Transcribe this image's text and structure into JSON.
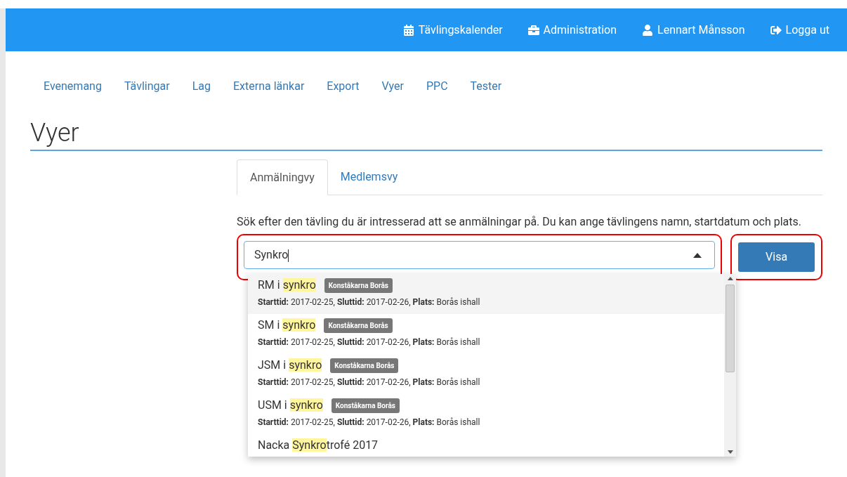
{
  "topbar": {
    "items": [
      {
        "kind": "calendar",
        "label": "Tävlingskalender"
      },
      {
        "kind": "briefcase",
        "label": "Administration"
      },
      {
        "kind": "user",
        "label": "Lennart Månsson"
      },
      {
        "kind": "logout",
        "label": "Logga ut"
      }
    ]
  },
  "nav": [
    "Evenemang",
    "Tävlingar",
    "Lag",
    "Externa länkar",
    "Export",
    "Vyer",
    "PPC",
    "Tester"
  ],
  "title": "Vyer",
  "tabs": [
    {
      "label": "Anmälningvy",
      "selected": true
    },
    {
      "label": "Medlemsvy",
      "selected": false
    }
  ],
  "description": "Sök efter den tävling du är intresserad att se anmälningar på. Du kan ange tävlingens namn, startdatum och plats.",
  "search": {
    "value": "Synkro",
    "expanded": true
  },
  "button": "Visa",
  "results": [
    {
      "pre": "RM i ",
      "match": "synkro",
      "badge": "Konståkarna Borås",
      "selected": true,
      "details": [
        {
          "label": "Starttid:",
          "value": "2017-02-25,"
        },
        {
          "label": "Sluttid:",
          "value": "2017-02-26,"
        },
        {
          "label": "Plats:",
          "value": "Borås ishall"
        }
      ]
    },
    {
      "pre": "SM i ",
      "match": "synkro",
      "badge": "Konståkarna Borås",
      "selected": false,
      "details": [
        {
          "label": "Starttid:",
          "value": "2017-02-25,"
        },
        {
          "label": "Sluttid:",
          "value": "2017-02-26,"
        },
        {
          "label": "Plats:",
          "value": "Borås ishall"
        }
      ]
    },
    {
      "pre": "JSM i ",
      "match": "synkro",
      "badge": "Konståkarna Borås",
      "selected": false,
      "details": [
        {
          "label": "Starttid:",
          "value": "2017-02-25,"
        },
        {
          "label": "Sluttid:",
          "value": "2017-02-26,"
        },
        {
          "label": "Plats:",
          "value": "Borås ishall"
        }
      ]
    },
    {
      "pre": "USM i ",
      "match": "synkro",
      "badge": "Konståkarna Borås",
      "selected": false,
      "details": [
        {
          "label": "Starttid:",
          "value": "2017-02-25,"
        },
        {
          "label": "Sluttid:",
          "value": "2017-02-26,"
        },
        {
          "label": "Plats:",
          "value": "Borås ishall"
        }
      ]
    },
    {
      "pre": "Nacka ",
      "match": "Synkro",
      "post": "trofé 2017",
      "selected": false
    }
  ]
}
